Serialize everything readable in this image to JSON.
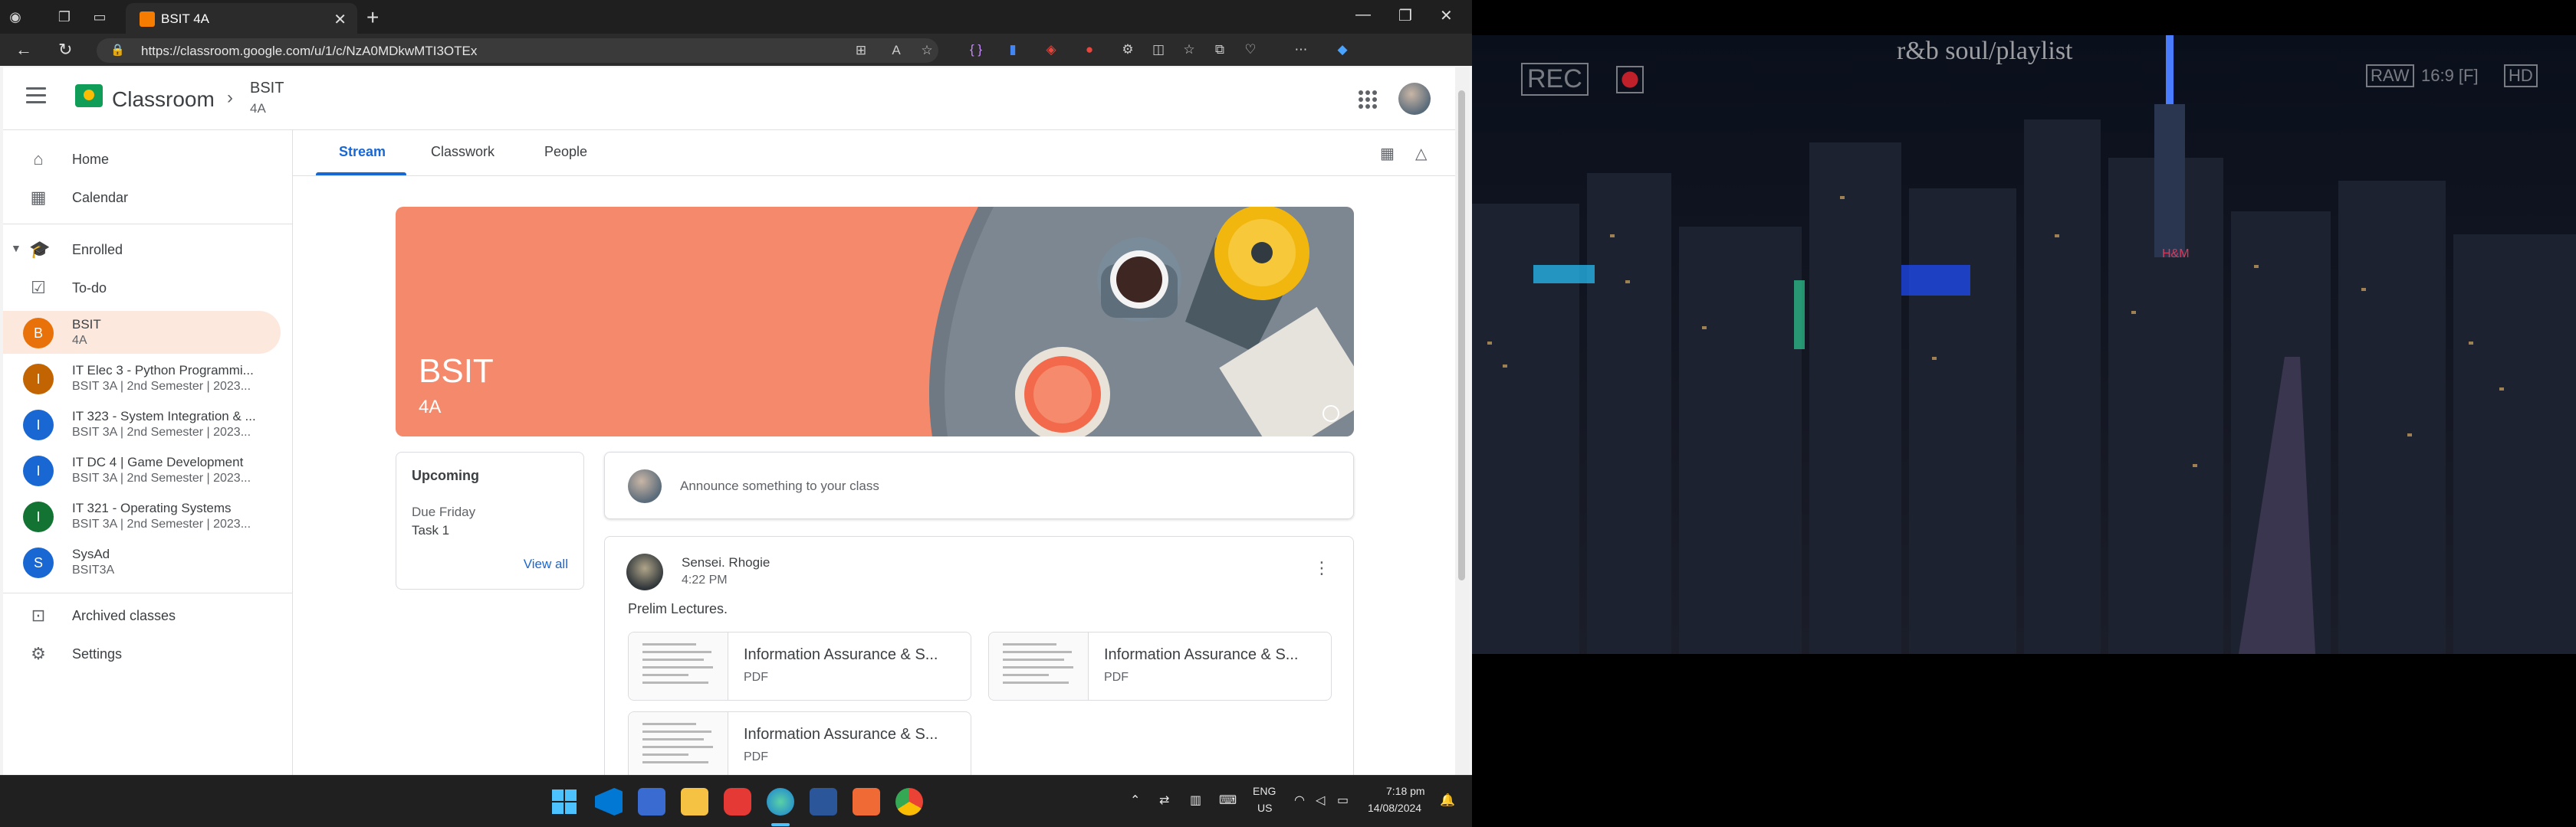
{
  "browser": {
    "tab_title": "BSIT 4A",
    "url": "https://classroom.google.com/u/1/c/NzA0MDkwMTI3OTEx"
  },
  "header": {
    "app_name": "Classroom",
    "class_name": "BSIT",
    "section": "4A"
  },
  "sidebar": {
    "home": "Home",
    "calendar": "Calendar",
    "enrolled": "Enrolled",
    "todo": "To-do",
    "classes": [
      {
        "letter": "B",
        "name": "BSIT",
        "sub": "4A",
        "color": "#e8710a"
      },
      {
        "letter": "I",
        "name": "IT Elec 3 - Python Programmi...",
        "sub": "BSIT 3A | 2nd Semester | 2023...",
        "color": "#c26401"
      },
      {
        "letter": "I",
        "name": "IT 323 - System Integration & ...",
        "sub": "BSIT 3A | 2nd Semester | 2023...",
        "color": "#1967d2"
      },
      {
        "letter": "I",
        "name": "IT DC 4 | Game Development",
        "sub": "BSIT 3A | 2nd Semester | 2023...",
        "color": "#1967d2"
      },
      {
        "letter": "I",
        "name": "IT 321 - Operating Systems",
        "sub": "BSIT 3A | 2nd Semester | 2023...",
        "color": "#137333"
      },
      {
        "letter": "S",
        "name": "SysAd",
        "sub": "BSIT3A",
        "color": "#1967d2"
      }
    ],
    "archived": "Archived classes",
    "settings": "Settings"
  },
  "tabs": {
    "stream": "Stream",
    "classwork": "Classwork",
    "people": "People"
  },
  "banner": {
    "title": "BSIT",
    "subtitle": "4A"
  },
  "upcoming": {
    "title": "Upcoming",
    "due": "Due Friday",
    "task": "Task 1",
    "view_all": "View all"
  },
  "announce": {
    "placeholder": "Announce something to your class"
  },
  "post": {
    "author": "Sensei. Rhogie",
    "time": "4:22 PM",
    "text": "Prelim Lectures.",
    "attachments": [
      {
        "name": "Information Assurance & S...",
        "type": "PDF"
      },
      {
        "name": "Information Assurance & S...",
        "type": "PDF"
      },
      {
        "name": "Information Assurance & S...",
        "type": "PDF"
      }
    ]
  },
  "taskbar": {
    "lang": "ENG",
    "region": "US",
    "time": "7:18 pm",
    "date": "14/08/2024"
  },
  "video": {
    "title": "r&b soul/playlist",
    "rec": "REC",
    "raw": "RAW",
    "ratio": "16:9 [F]",
    "hd": "HD"
  },
  "colors": {
    "accent": "#1967d2",
    "banner": "#f4896b",
    "active_class_bg": "#fde8de"
  }
}
